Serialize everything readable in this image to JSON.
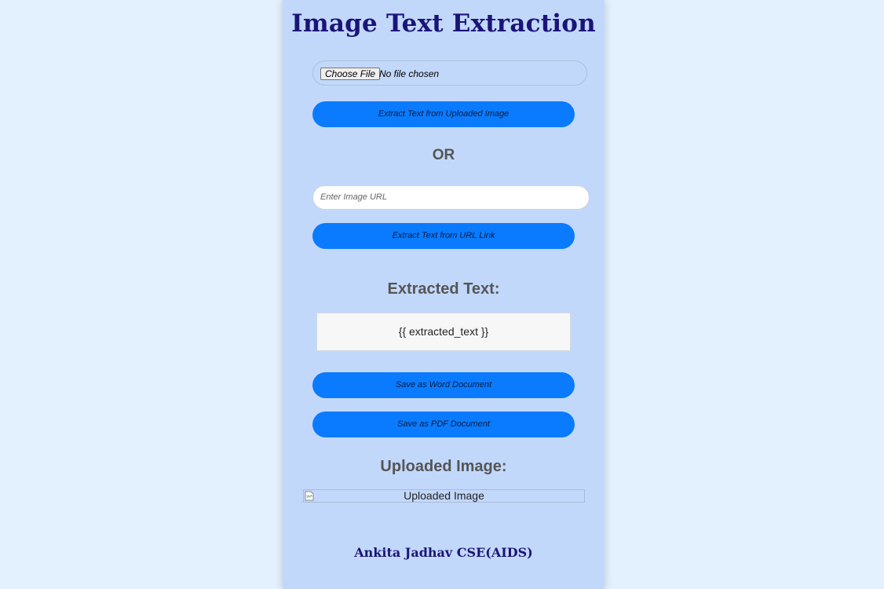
{
  "app": {
    "title": "Image Text Extraction"
  },
  "upload": {
    "choose_label": "Choose File",
    "file_status": "No file chosen",
    "extract_button": "Extract Text from Uploaded Image"
  },
  "divider": "OR",
  "url": {
    "placeholder": "Enter Image URL",
    "extract_button": "Extract Text from URL Link"
  },
  "result": {
    "heading": "Extracted Text:",
    "text": "{{ extracted_text }}"
  },
  "actions": {
    "save_word": "Save as Word Document",
    "save_pdf": "Save as PDF Document"
  },
  "uploaded": {
    "heading": "Uploaded Image:",
    "alt_text": "Uploaded Image"
  },
  "footer": {
    "credit": "Ankita Jadhav CSE(AIDS)"
  },
  "colors": {
    "page_bg": "#e3f0fd",
    "panel_bg": "#c2d8fb",
    "button_blue": "#0a7bff",
    "title_navy": "#1b1478"
  },
  "icons": {
    "broken_image": "broken-image-icon"
  }
}
